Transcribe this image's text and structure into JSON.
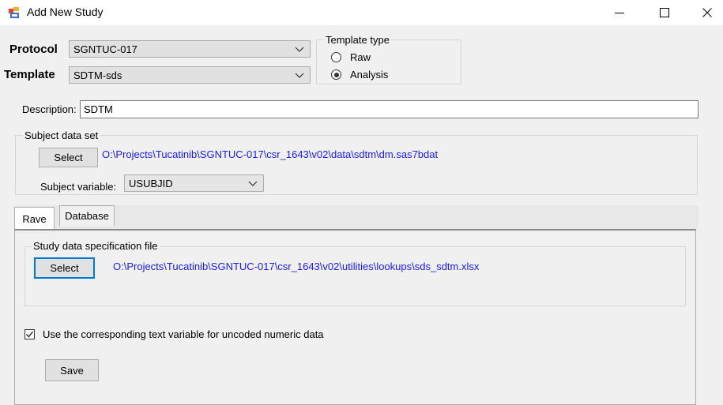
{
  "window": {
    "title": "Add New Study"
  },
  "protocol": {
    "label": "Protocol",
    "value": "SGNTUC-017"
  },
  "template": {
    "label": "Template",
    "value": "SDTM-sds"
  },
  "template_type": {
    "title": "Template type",
    "options": [
      {
        "label": "Raw",
        "selected": false
      },
      {
        "label": "Analysis",
        "selected": true
      }
    ]
  },
  "description": {
    "label": "Description:",
    "value": "SDTM"
  },
  "subject_data_set": {
    "title": "Subject data set",
    "select_label": "Select",
    "path": "O:\\Projects\\Tucatinib\\SGNTUC-017\\csr_1643\\v02\\data\\sdtm\\dm.sas7bdat",
    "variable_label": "Subject variable:",
    "variable_value": "USUBJID"
  },
  "tabs": [
    {
      "label": "Rave",
      "active": true
    },
    {
      "label": "Database",
      "active": false
    }
  ],
  "study_spec": {
    "title": "Study data specification file",
    "select_label": "Select",
    "path": "O:\\Projects\\Tucatinib\\SGNTUC-017\\csr_1643\\v02\\utilities\\lookups\\sds_sdtm.xlsx"
  },
  "uncoded_checkbox": {
    "label": "Use the corresponding text variable for uncoded numeric data",
    "checked": true
  },
  "save_label": "Save"
}
